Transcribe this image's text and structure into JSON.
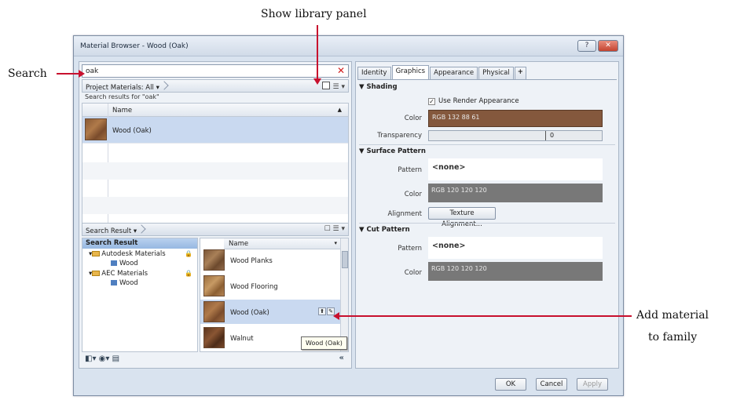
{
  "annotations": {
    "show_library_panel": "Show library panel",
    "search": "Search",
    "add_material_line1": "Add material",
    "add_material_line2": "to family"
  },
  "window": {
    "title": "Material Browser - Wood (Oak)",
    "help_label": "?",
    "close_label": "✕"
  },
  "search": {
    "value": "oak",
    "clear_label": "✕"
  },
  "project_bar": {
    "label": "Project Materials: All",
    "dropdown": "▾"
  },
  "results_label": "Search results for \"oak\"",
  "project_grid": {
    "column": "Name",
    "sort": "▲",
    "rows": [
      {
        "name": "Wood (Oak)"
      }
    ]
  },
  "library_bar": {
    "label": "Search Result",
    "dropdown": "▾",
    "icons": "☐ ☰ ▾"
  },
  "tree": {
    "header": "Search Result",
    "items": [
      {
        "label": "Autodesk Materials",
        "lock": "🔒"
      },
      {
        "label": "Wood"
      },
      {
        "label": "AEC Materials",
        "lock": "🔒"
      },
      {
        "label": "Wood"
      }
    ]
  },
  "library_list": {
    "column": "Name",
    "dropdown": "▾",
    "items": [
      {
        "name": "Wood Planks"
      },
      {
        "name": "Wood Flooring"
      },
      {
        "name": "Wood (Oak)"
      },
      {
        "name": "Walnut"
      }
    ],
    "add_button": "⬆",
    "edit_button": "✎"
  },
  "tooltip": "Wood (Oak)",
  "left_footer": {
    "icons": "◧▾ ◉▾ ▤",
    "collapse": "«"
  },
  "tabs": [
    {
      "label": "Identity"
    },
    {
      "label": "Graphics"
    },
    {
      "label": "Appearance"
    },
    {
      "label": "Physical"
    },
    {
      "label": "+"
    }
  ],
  "shading": {
    "header": "▼ Shading",
    "use_render_label": "Use Render Appearance",
    "checked": "✓",
    "color_label": "Color",
    "color_value": "RGB 132 88 61",
    "color_hex": "#84583d",
    "transparency_label": "Transparency",
    "transparency_value": "0"
  },
  "surface_pattern": {
    "header": "▼ Surface Pattern",
    "pattern_label": "Pattern",
    "pattern_value": "<none>",
    "color_label": "Color",
    "color_value": "RGB 120 120 120",
    "color_hex": "#787878",
    "alignment_label": "Alignment",
    "alignment_button": "Texture Alignment..."
  },
  "cut_pattern": {
    "header": "▼ Cut Pattern",
    "pattern_label": "Pattern",
    "pattern_value": "<none>",
    "color_label": "Color",
    "color_value": "RGB 120 120 120",
    "color_hex": "#787878"
  },
  "footer_buttons": {
    "ok": "OK",
    "cancel": "Cancel",
    "apply": "Apply"
  }
}
